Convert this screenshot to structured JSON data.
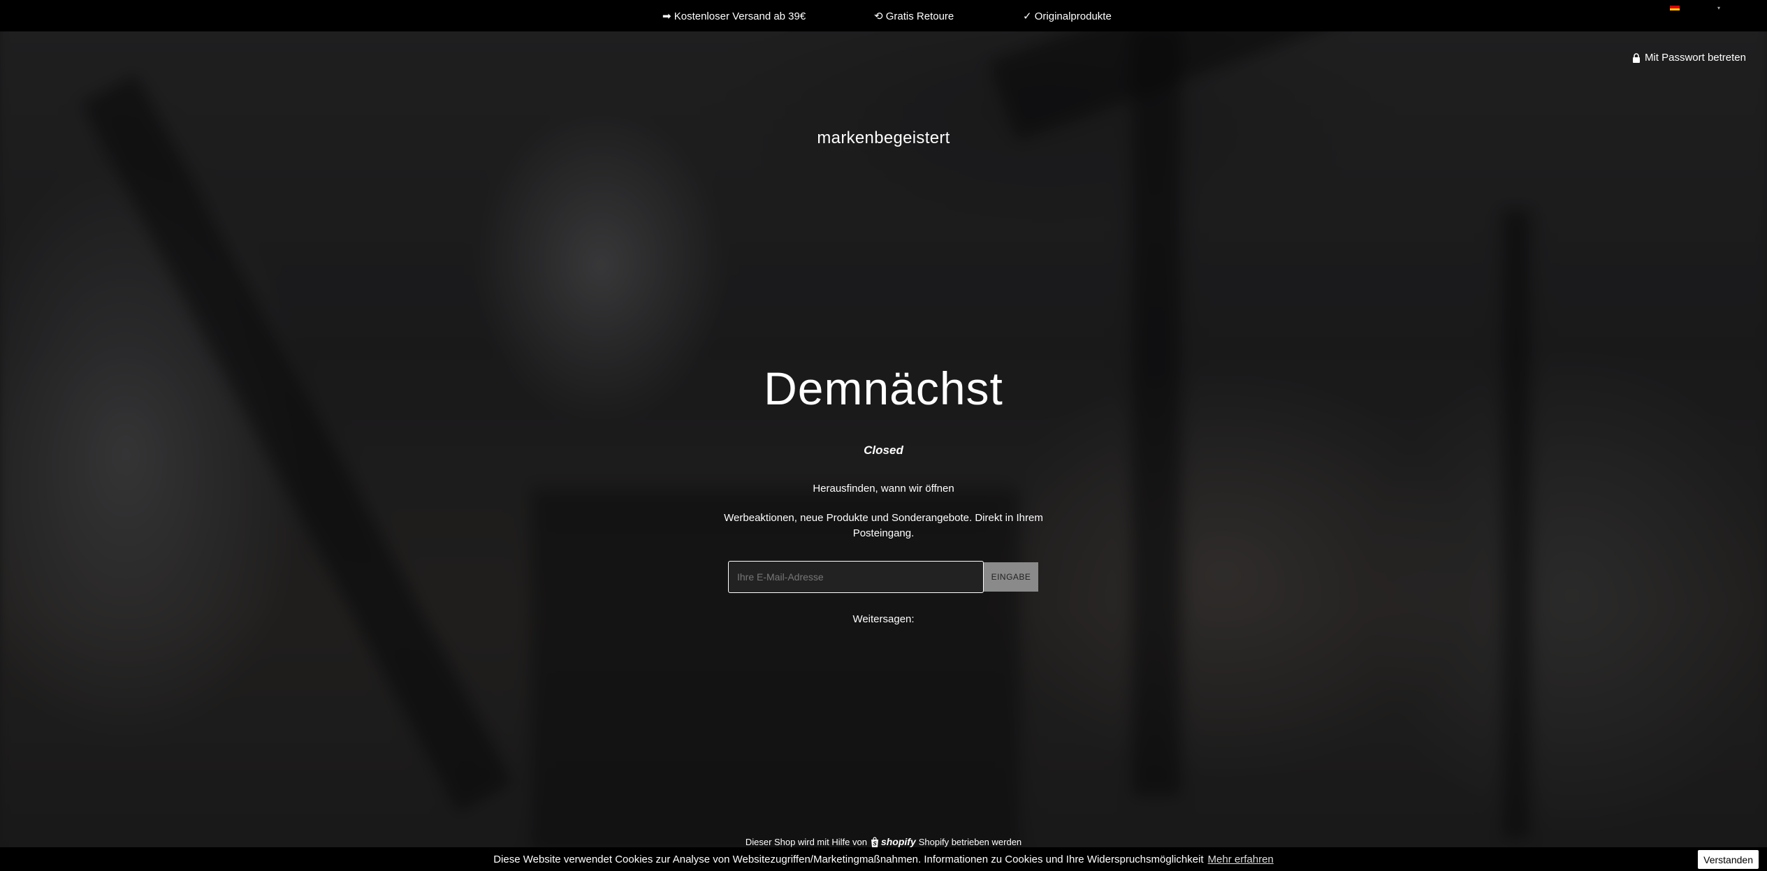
{
  "announcement": {
    "items": [
      "➡ Kostenloser Versand ab 39€",
      "⟲ Gratis Retoure",
      "✓ Originalprodukte"
    ]
  },
  "language": {
    "flag_colors": [
      "#000000",
      "#DD0000",
      "#FFCE00"
    ]
  },
  "header": {
    "password_link": "Mit Passwort betreten",
    "brand": "markenbegeistert"
  },
  "main": {
    "headline": "Demnächst",
    "subtitle": "Closed",
    "find_out": "Herausfinden, wann wir öffnen",
    "promo": "Werbeaktionen, neue Produkte und Sonderangebote. Direkt in Ihrem Posteingang.",
    "email_placeholder": "Ihre E-Mail-Adresse",
    "email_value": "",
    "submit_label": "EINGABE",
    "share_label": "Weitersagen:"
  },
  "footer": {
    "powered_prefix": "Dieser Shop wird mit Hilfe von",
    "shopify_logo_text": "shopify",
    "powered_suffix": "Shopify betrieben werden"
  },
  "cookie": {
    "text": "Diese Website verwendet Cookies zur Analyse von Websitezugriffen/Marketingmaßnahmen. Informationen zu Cookies und Ihre Widerspruchsmöglichkeit",
    "link": "Mehr erfahren",
    "button": "Verstanden"
  },
  "colors": {
    "bar_background": "#000000",
    "submit_background": "#8a8a8a"
  }
}
